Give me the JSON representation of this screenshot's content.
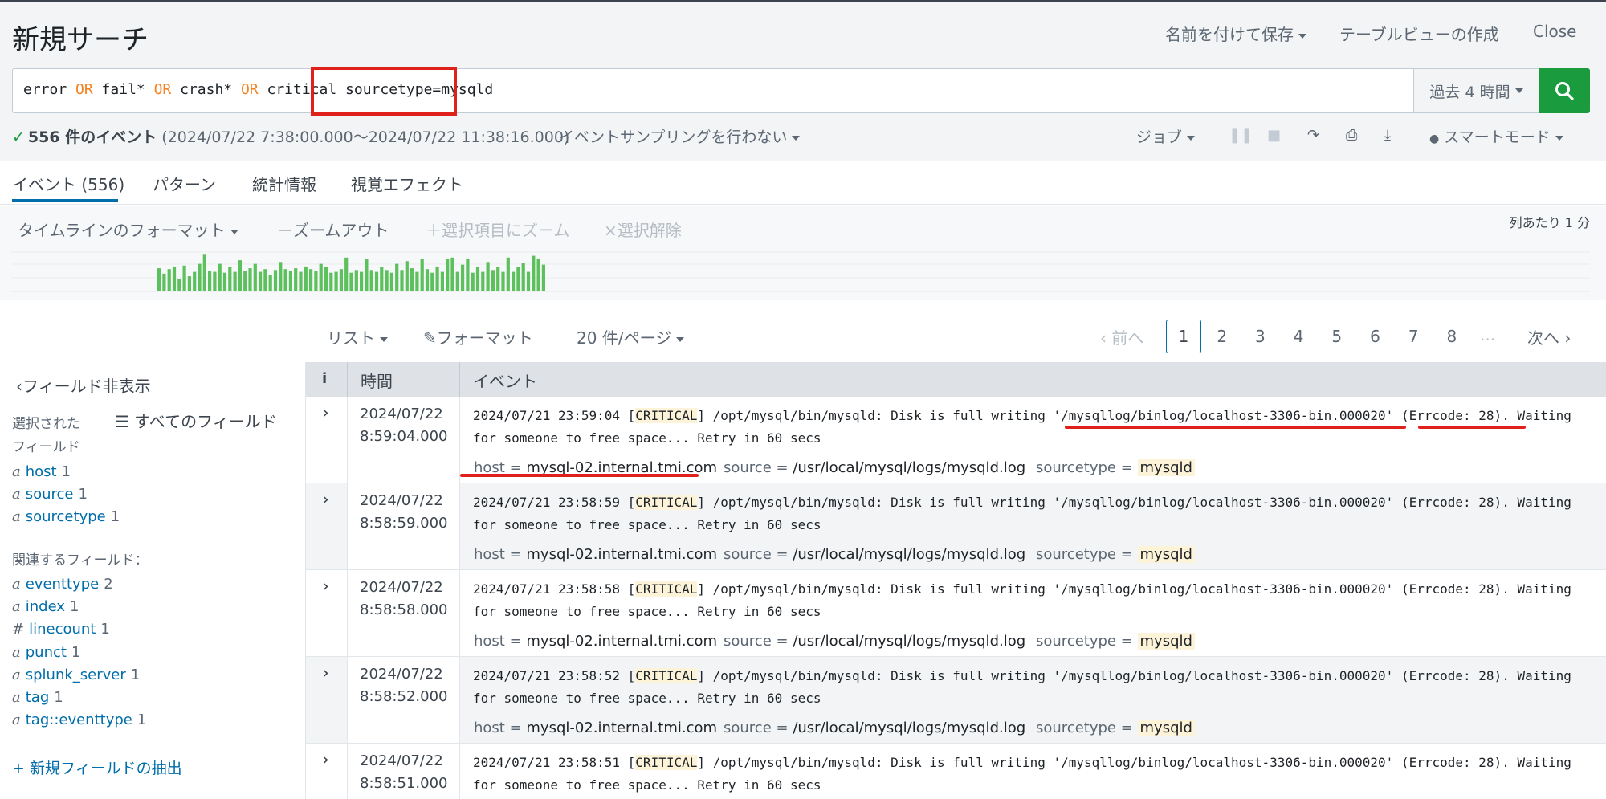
{
  "header": {
    "title": "新規サーチ",
    "save_as": "名前を付けて保存",
    "create_table": "テーブルビューの作成",
    "close": "Close"
  },
  "search": {
    "query_parts": [
      {
        "text": "error ",
        "kw": false
      },
      {
        "text": "OR",
        "kw": true
      },
      {
        "text": " fail* ",
        "kw": false
      },
      {
        "text": "OR",
        "kw": true
      },
      {
        "text": " crash* ",
        "kw": false
      },
      {
        "text": "OR",
        "kw": true
      },
      {
        "text": " critical ",
        "kw": false
      },
      {
        "text": "sourcetype=mysqld",
        "kw": false
      }
    ],
    "time_range": "過去 4 時間"
  },
  "status": {
    "count": "556 件のイベント",
    "range": "(2024/07/22 7:38:00.000〜2024/07/22 11:38:16.000)",
    "sampling": "イベントサンプリングを行わない",
    "jobs": "ジョブ",
    "mode": "スマートモード"
  },
  "tabs": {
    "events": "イベント (556)",
    "patterns": "パターン",
    "statistics": "統計情報",
    "visualization": "視覚エフェクト"
  },
  "timeline": {
    "format": "タイムラインのフォーマット",
    "zoom_out": "－ズームアウト",
    "zoom_selection": "＋選択項目にズーム",
    "deselect": "×選択解除",
    "per_column": "列あたり 1 分"
  },
  "chart_data": {
    "type": "bar",
    "values": [
      26,
      20,
      25,
      28,
      14,
      29,
      17,
      22,
      31,
      42,
      23,
      22,
      31,
      21,
      27,
      22,
      35,
      23,
      26,
      31,
      22,
      25,
      18,
      24,
      33,
      25,
      23,
      26,
      22,
      28,
      25,
      23,
      31,
      27,
      21,
      22,
      25,
      38,
      21,
      24,
      22,
      36,
      24,
      22,
      27,
      24,
      21,
      31,
      24,
      34,
      26,
      22,
      36,
      25,
      21,
      28,
      22,
      36,
      38,
      22,
      30,
      37,
      21,
      27,
      22,
      33,
      24,
      27,
      22,
      38,
      22,
      27,
      32,
      22,
      40,
      37,
      30
    ],
    "color": "#5cc05c"
  },
  "paging": {
    "list": "リスト",
    "format": "フォーマット",
    "per_page": "20 件/ページ",
    "prev": "前へ",
    "pages": [
      "1",
      "2",
      "3",
      "4",
      "5",
      "6",
      "7",
      "8"
    ],
    "ellipsis": "...",
    "next": "次へ"
  },
  "sidebar": {
    "hide_fields": "フィールド非表示",
    "all_fields": "すべてのフィールド",
    "selected_heading_1": "選択された",
    "selected_heading_2": "フィールド",
    "selected": [
      {
        "type": "a",
        "name": "host",
        "count": "1"
      },
      {
        "type": "a",
        "name": "source",
        "count": "1"
      },
      {
        "type": "a",
        "name": "sourcetype",
        "count": "1"
      }
    ],
    "related_heading": "関連するフィールド：",
    "related": [
      {
        "type": "a",
        "name": "eventtype",
        "count": "2"
      },
      {
        "type": "a",
        "name": "index",
        "count": "1"
      },
      {
        "type": "#",
        "name": "linecount",
        "count": "1"
      },
      {
        "type": "a",
        "name": "punct",
        "count": "1"
      },
      {
        "type": "a",
        "name": "splunk_server",
        "count": "1"
      },
      {
        "type": "a",
        "name": "tag",
        "count": "1"
      },
      {
        "type": "a",
        "name": "tag::eventtype",
        "count": "1"
      }
    ],
    "extract": "+ 新規フィールドの抽出"
  },
  "table": {
    "col_i": "i",
    "col_time": "時間",
    "col_event": "イベント",
    "meta_host_key": "host = ",
    "meta_source_key": "source = ",
    "meta_sourcetype_key": "sourcetype = ",
    "rows": [
      {
        "date": "2024/07/22",
        "time": "8:58:59.000",
        "ts": "2024/07/21 23:58:59"
      },
      {
        "date": "2024/07/22",
        "time": "8:58:58.000",
        "ts": "2024/07/21 23:58:58"
      },
      {
        "date": "2024/07/22",
        "time": "8:58:52.000",
        "ts": "2024/07/21 23:58:52"
      },
      {
        "date": "2024/07/22",
        "time": "8:58:51.000",
        "ts": "2024/07/21 23:58:51"
      }
    ],
    "first_row": {
      "date": "2024/07/22",
      "time": "8:59:04.000",
      "ts": "2024/07/21 23:59:04"
    },
    "level": "CRITICAL",
    "msg_a": "] /opt/mysql/bin/mysqld: Disk is full writing ",
    "path": "'/mysqllog/binlog/localhost-3306-bin.000020'",
    "errcode": "(Errcode: 28)",
    "msg_b": ". Waiting",
    "msg_c": "for someone to free space... Retry in 60 secs",
    "host": "mysql-02.internal.tmi.com",
    "source": "/usr/local/mysql/logs/mysqld.log",
    "sourcetype": "mysqld"
  }
}
